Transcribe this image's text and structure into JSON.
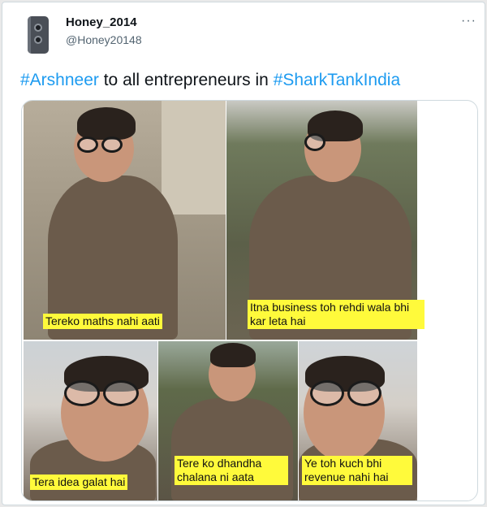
{
  "tweet": {
    "display_name": "Honey_2014",
    "handle": "@Honey20148",
    "more_label": "···",
    "text_parts": [
      {
        "text": "#Arshneer",
        "hashtag": true
      },
      {
        "text": " to all entrepreneurs in ",
        "hashtag": false
      },
      {
        "text": "#SharkTankIndia",
        "hashtag": true
      }
    ]
  },
  "media": {
    "captions": [
      "Tereko maths nahi aati",
      "Itna business toh rehdi wala bhi kar leta hai",
      "Tera idea galat hai",
      "Tere ko dhandha chalana ni aata",
      "Ye toh kuch bhi revenue nahi hai"
    ]
  },
  "colors": {
    "hashtag": "#1d9bf0",
    "caption_bg": "#fffa3b",
    "text_primary": "#0f1419",
    "text_secondary": "#536471"
  },
  "icons": {
    "avatar": "phone-avatar-image",
    "more": "more-options-icon"
  }
}
